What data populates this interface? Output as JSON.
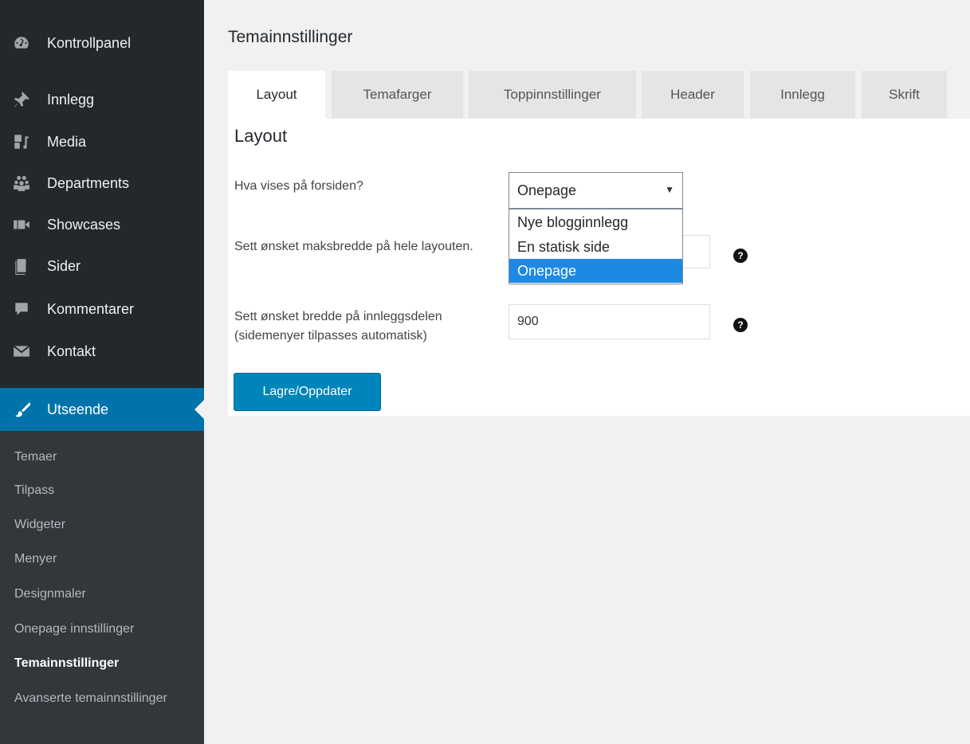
{
  "sidebar": {
    "items": [
      {
        "label": "Kontrollpanel",
        "icon": "dashboard-icon"
      },
      {
        "label": "Innlegg",
        "icon": "pin-icon"
      },
      {
        "label": "Media",
        "icon": "media-icon"
      },
      {
        "label": "Departments",
        "icon": "groups-icon"
      },
      {
        "label": "Showcases",
        "icon": "video-icon"
      },
      {
        "label": "Sider",
        "icon": "pages-icon"
      },
      {
        "label": "Kommentarer",
        "icon": "comments-icon"
      },
      {
        "label": "Kontakt",
        "icon": "email-icon"
      },
      {
        "label": "Utseende",
        "icon": "brush-icon"
      }
    ],
    "submenu": [
      {
        "label": "Temaer"
      },
      {
        "label": "Tilpass"
      },
      {
        "label": "Widgeter"
      },
      {
        "label": "Menyer"
      },
      {
        "label": "Designmaler"
      },
      {
        "label": "Onepage innstillinger"
      },
      {
        "label": "Temainnstillinger"
      },
      {
        "label": "Avanserte temainnstillinger"
      }
    ],
    "active_color": "#0073aa"
  },
  "page": {
    "title": "Temainnstillinger",
    "tabs": [
      {
        "label": "Layout"
      },
      {
        "label": "Temafarger"
      },
      {
        "label": "Toppinnstillinger"
      },
      {
        "label": "Header"
      },
      {
        "label": "Innlegg"
      },
      {
        "label": "Skrift"
      }
    ],
    "section_title": "Layout",
    "fields": {
      "front_label": "Hva vises på forsiden?",
      "front_value": "Onepage",
      "front_options": [
        "Nye blogginnlegg",
        "En statisk side",
        "Onepage"
      ],
      "maxwidth_label": "Sett ønsket maksbredde på hele layouten.",
      "content_width_label": "Sett ønsket bredde på innleggsdelen (sidemenyer tilpasses automatisk)",
      "content_width_value": "900",
      "help_glyph": "?"
    },
    "save_label": "Lagre/Oppdater"
  }
}
